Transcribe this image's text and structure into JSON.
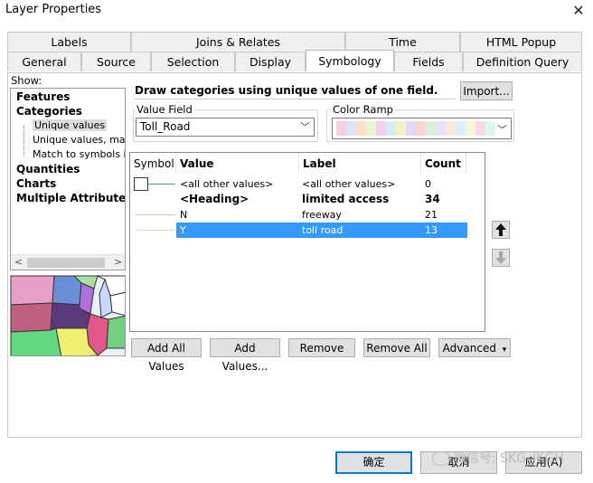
{
  "window": {
    "title": "Layer Properties",
    "close_glyph": "✕"
  },
  "tabs_top": [
    "Labels",
    "Joins & Relates",
    "Time",
    "HTML Popup"
  ],
  "tabs_bottom": [
    "General",
    "Source",
    "Selection",
    "Display",
    "Symbology",
    "Fields",
    "Definition Query"
  ],
  "active_tab": "Symbology",
  "show": {
    "label": "Show:",
    "items": [
      {
        "label": "Features",
        "level": 0
      },
      {
        "label": "Categories",
        "level": 0
      },
      {
        "label": "Unique values",
        "level": 1,
        "selected": true
      },
      {
        "label": "Unique values, many",
        "level": 1
      },
      {
        "label": "Match to symbols in a",
        "level": 1
      },
      {
        "label": "Quantities",
        "level": 0
      },
      {
        "label": "Charts",
        "level": 0
      },
      {
        "label": "Multiple Attributes",
        "level": 0
      }
    ],
    "scroll_left": "<",
    "scroll_right": ">"
  },
  "description": "Draw categories using unique values of one field.",
  "import_label": "Import...",
  "value_field": {
    "label": "Value Field",
    "value": "Toll_Road"
  },
  "color_ramp": {
    "label": "Color Ramp",
    "colors": [
      "#f6cfe0",
      "#d8e6f8",
      "#f8e0c8",
      "#e6f6d0",
      "#f0d0f0",
      "#d0f0ec",
      "#f8f0c8",
      "#e0d8f8",
      "#f8d4d4",
      "#d4f4d8",
      "#e8e0ff",
      "#ffe8d8",
      "#d8f0ff",
      "#f4f8d4",
      "#f8d8ec",
      "#dcf8e8"
    ]
  },
  "table": {
    "headers": {
      "symbol": "Symbol",
      "value": "Value",
      "label": "Label",
      "count": "Count"
    },
    "rows": [
      {
        "value": "<all other values>",
        "label": "<all other values>",
        "count": "0",
        "type": "other"
      },
      {
        "value": "<Heading>",
        "label": "limited access",
        "count": "34",
        "type": "heading"
      },
      {
        "value": "N",
        "label": "freeway",
        "count": "21",
        "type": "normal"
      },
      {
        "value": "Y",
        "label": "toll road",
        "count": "13",
        "type": "selected"
      }
    ]
  },
  "buttons": {
    "add_all": "Add All Values",
    "add": "Add Values...",
    "remove": "Remove",
    "remove_all": "Remove All",
    "advanced": "Advanced",
    "advanced_arrow": "▾"
  },
  "footer": {
    "ok": "确定",
    "cancel": "取消",
    "apply": "应用(A)",
    "watermark": "微信号: SKG_IKGH"
  },
  "colors": {
    "selection": "#3399ff",
    "accent": "#0078d7",
    "symbol_line": "#4caf50"
  }
}
